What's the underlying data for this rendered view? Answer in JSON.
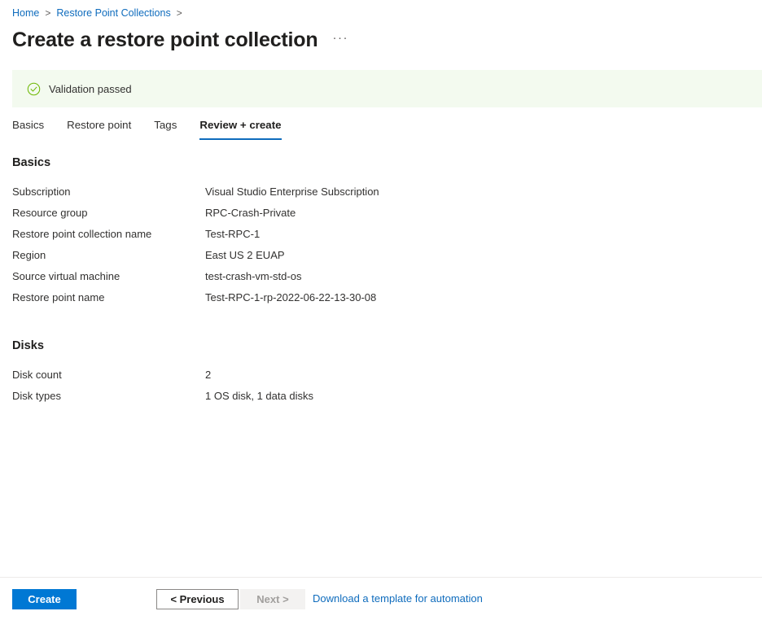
{
  "breadcrumb": {
    "items": [
      {
        "label": "Home"
      },
      {
        "label": "Restore Point Collections"
      }
    ],
    "separator": ">"
  },
  "header": {
    "title": "Create a restore point collection",
    "more_label": "···"
  },
  "banner": {
    "status": "success",
    "text": "Validation passed",
    "icon": "check-circle-icon",
    "background": "#f3faef",
    "icon_color": "#6bb700"
  },
  "tabs": [
    {
      "label": "Basics",
      "active": false
    },
    {
      "label": "Restore point",
      "active": false
    },
    {
      "label": "Tags",
      "active": false
    },
    {
      "label": "Review + create",
      "active": true
    }
  ],
  "sections": [
    {
      "heading": "Basics",
      "rows": [
        {
          "label": "Subscription",
          "value": "Visual Studio Enterprise Subscription"
        },
        {
          "label": "Resource group",
          "value": "RPC-Crash-Private"
        },
        {
          "label": "Restore point collection name",
          "value": "Test-RPC-1"
        },
        {
          "label": "Region",
          "value": "East US 2 EUAP"
        },
        {
          "label": "Source virtual machine",
          "value": "test-crash-vm-std-os"
        },
        {
          "label": "Restore point name",
          "value": "Test-RPC-1-rp-2022-06-22-13-30-08"
        }
      ]
    },
    {
      "heading": "Disks",
      "rows": [
        {
          "label": "Disk count",
          "value": "2"
        },
        {
          "label": "Disk types",
          "value": "1 OS disk, 1 data disks"
        }
      ]
    }
  ],
  "footer": {
    "create_label": "Create",
    "previous_label": "< Previous",
    "next_label": "Next >",
    "template_link_label": "Download a template for automation",
    "accent_color": "#0078d4",
    "link_color": "#0f6cbd"
  }
}
